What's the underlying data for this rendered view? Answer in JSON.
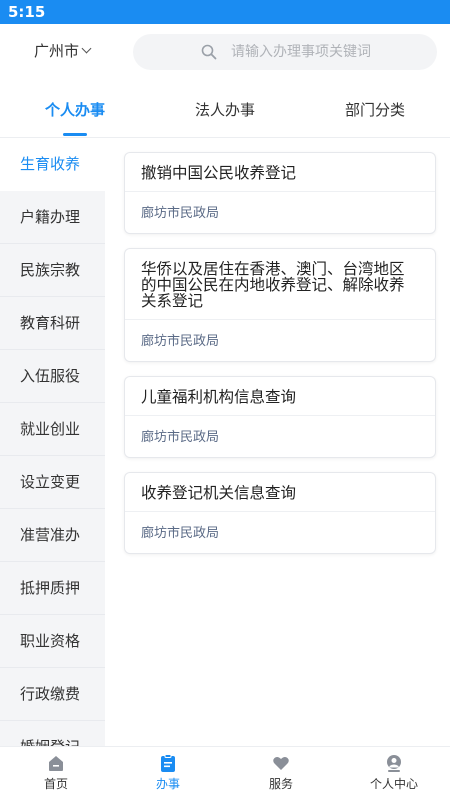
{
  "status_bar": {
    "time": "5:15"
  },
  "header": {
    "city": "广州市",
    "search_placeholder": "请输入办理事项关键词"
  },
  "tabs": [
    {
      "label": "个人办事",
      "active": true
    },
    {
      "label": "法人办事",
      "active": false
    },
    {
      "label": "部门分类",
      "active": false
    }
  ],
  "sidebar": {
    "items": [
      {
        "label": "生育收养",
        "active": true
      },
      {
        "label": "户籍办理",
        "active": false
      },
      {
        "label": "民族宗教",
        "active": false
      },
      {
        "label": "教育科研",
        "active": false
      },
      {
        "label": "入伍服役",
        "active": false
      },
      {
        "label": "就业创业",
        "active": false
      },
      {
        "label": "设立变更",
        "active": false
      },
      {
        "label": "准营准办",
        "active": false
      },
      {
        "label": "抵押质押",
        "active": false
      },
      {
        "label": "职业资格",
        "active": false
      },
      {
        "label": "行政缴费",
        "active": false
      },
      {
        "label": "婚姻登记",
        "active": false
      }
    ]
  },
  "services": [
    {
      "title": "撤销中国公民收养登记",
      "dept": "廊坊市民政局"
    },
    {
      "title": "华侨以及居住在香港、澳门、台湾地区的中国公民在内地收养登记、解除收养关系登记",
      "dept": "廊坊市民政局"
    },
    {
      "title": "儿童福利机构信息查询",
      "dept": "廊坊市民政局"
    },
    {
      "title": "收养登记机关信息查询",
      "dept": "廊坊市民政局"
    }
  ],
  "bottom_nav": [
    {
      "label": "首页",
      "icon": "home-icon",
      "active": false
    },
    {
      "label": "办事",
      "icon": "clipboard-icon",
      "active": true
    },
    {
      "label": "服务",
      "icon": "heart-icon",
      "active": false
    },
    {
      "label": "个人中心",
      "icon": "user-icon",
      "active": false
    }
  ],
  "colors": {
    "accent": "#1a8cf2",
    "sidebar_bg": "#f4f5f7",
    "dept_text": "#5a6a86"
  }
}
